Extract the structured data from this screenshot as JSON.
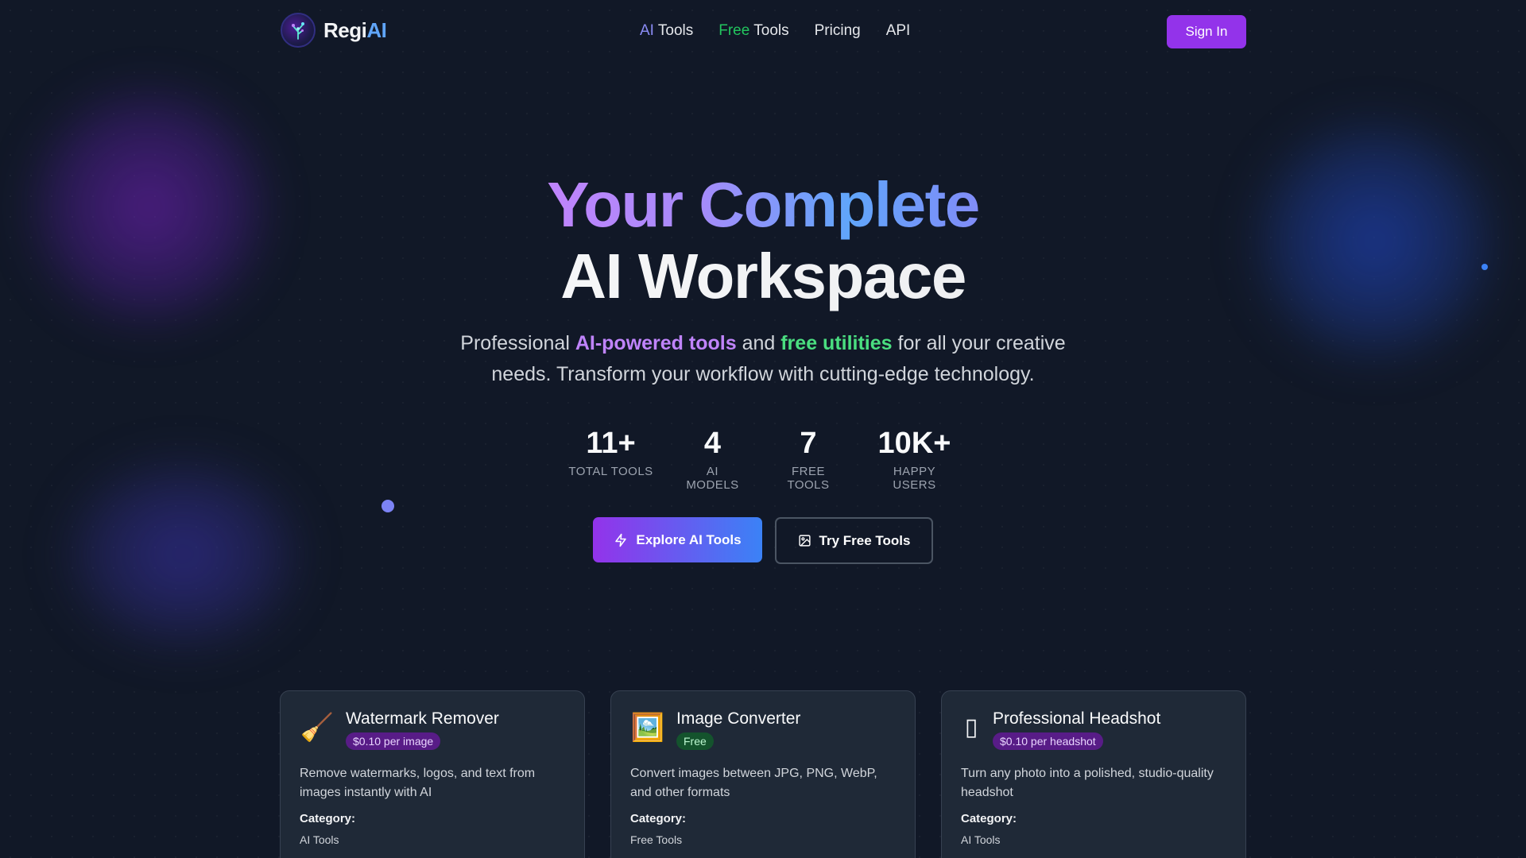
{
  "header": {
    "logo_text_main": "Regi",
    "logo_text_accent": "AI",
    "nav": [
      {
        "prefix": "AI",
        "label": " Tools",
        "prefix_color": "#8b8cf6"
      },
      {
        "prefix": "Free",
        "label": " Tools",
        "prefix_color": "#22c55e"
      },
      {
        "prefix": "",
        "label": "Pricing"
      },
      {
        "prefix": "",
        "label": "API"
      }
    ],
    "sign_in_label": "Sign In"
  },
  "hero": {
    "title_line1": "Your Complete",
    "title_line2": "AI Workspace",
    "subtitle_prefix": "Professional ",
    "subtitle_highlight1": "AI-powered tools",
    "subtitle_mid": " and ",
    "subtitle_highlight2": "free utilities",
    "subtitle_suffix": " for all your creative needs. Transform your workflow with cutting-edge technology."
  },
  "stats": [
    {
      "value": "11+",
      "label": "TOTAL TOOLS"
    },
    {
      "value": "4",
      "label": "AI MODELS"
    },
    {
      "value": "7",
      "label": "FREE TOOLS"
    },
    {
      "value": "10K+",
      "label": "HAPPY USERS"
    }
  ],
  "cta": {
    "primary_label": "Explore AI Tools",
    "secondary_label": "Try Free Tools"
  },
  "cards": [
    {
      "icon": "broom-icon",
      "glyph": "🧹",
      "title": "Watermark Remover",
      "badge": "$0.10 per image",
      "badge_type": "paid",
      "description": "Remove watermarks, logos, and text from images instantly with AI",
      "category_label": "Category:",
      "category": "AI Tools"
    },
    {
      "icon": "framed-picture-icon",
      "glyph": "🖼️",
      "title": "Image Converter",
      "badge": "Free",
      "badge_type": "free",
      "description": "Convert images between JPG, PNG, WebP, and other formats",
      "category_label": "Category:",
      "category": "Free Tools"
    },
    {
      "icon": "missing-glyph-icon",
      "glyph": "▯",
      "title": "Professional Headshot",
      "badge": "$0.10 per headshot",
      "badge_type": "paid",
      "description": "Turn any photo into a polished, studio-quality headshot",
      "category_label": "Category:",
      "category": "AI Tools"
    }
  ]
}
